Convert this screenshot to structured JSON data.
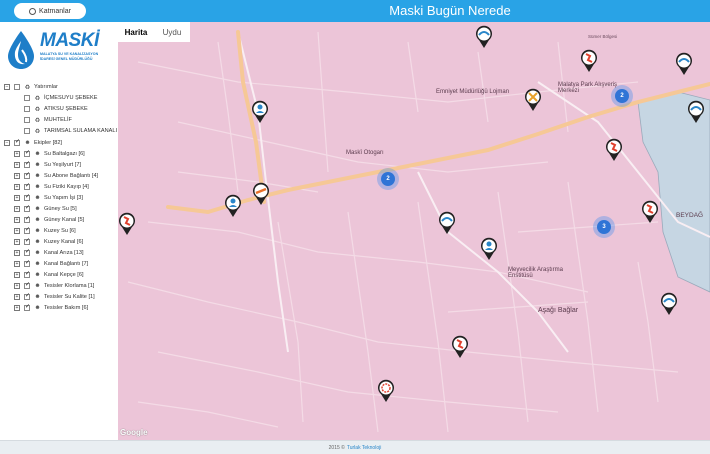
{
  "header": {
    "title": "Maski Bugün Nerede",
    "layers_button": "Katmanlar"
  },
  "logo": {
    "name": "MASKİ",
    "subtitle": "MALATYA SU VE KANALİZASYON İDARESİ GENEL MÜDÜRLÜĞÜ"
  },
  "sidebar": {
    "yatirimlar": {
      "label": "Yatırımlar",
      "children": [
        "İÇMESUYU ŞEBEKE",
        "ATIKSU ŞEBEKE",
        "MUHTELİF",
        "TARIMSAL SULAMA KANALI"
      ]
    },
    "ekipler": {
      "label": "Ekipler [82]",
      "children": [
        "Su Baltalgazı [6]",
        "Su Yeşilyurt [7]",
        "Su Abone Bağlantı [4]",
        "Su Fiziki Kayıp [4]",
        "Su Yapım İşi [3]",
        "Güney Su [5]",
        "Güney Kanal [5]",
        "Kuzey Su [6]",
        "Kuzey Kanal [6]",
        "Kanal Arıza [13]",
        "Kanal Bağlantı [7]",
        "Kanal Kepçe [6]",
        "Tesisler Klorlama [1]",
        "Tesisler Su Kalite [1]",
        "Tesisler Bakım [6]"
      ]
    }
  },
  "map": {
    "tabs": {
      "harita": "Harita",
      "uydu": "Uydu"
    },
    "labels": {
      "emniyet": "Emniyet Müdürlüğü Lojman",
      "malatya_park": "Malatya Park Alışveriş Merkezi",
      "maski_otogar": "Maskî Otogarı",
      "meyvecilik": "Meyvecilik Araştırma Enstitüsü",
      "asagi_baglar": "Aşağı Bağlar",
      "beydag": "BEYDAĞ",
      "sumer": "Sümer Bölgesi"
    },
    "clusters": [
      "2",
      "2",
      "3"
    ],
    "google": "Google"
  },
  "footer": {
    "text": "2015 ©",
    "link": "Turlak Teknoloji"
  },
  "colors": {
    "header": "#29a3e6",
    "map_bg": "#ecc5d8",
    "road_major": "#f6c896",
    "cluster": "#2f74d6"
  }
}
